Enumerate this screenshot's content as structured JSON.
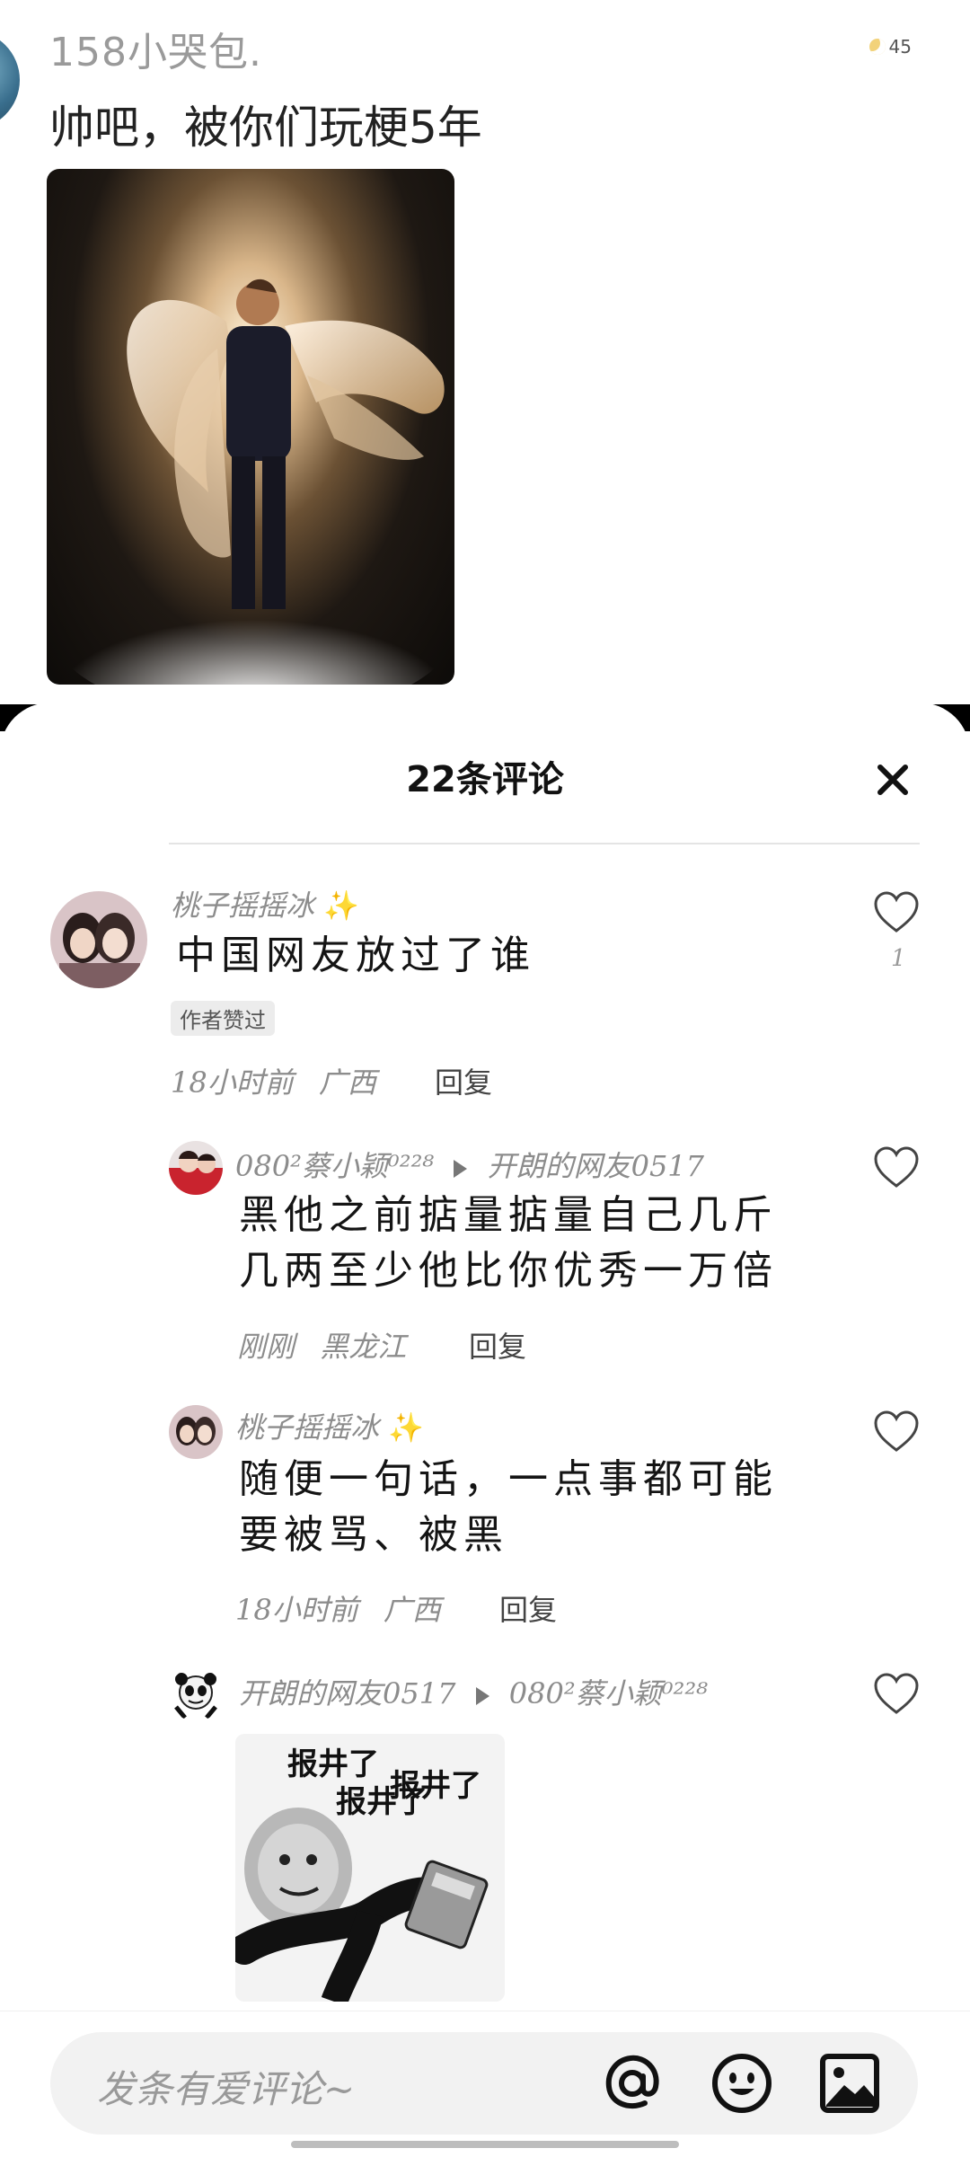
{
  "post": {
    "author": "158小哭包.",
    "title": "帅吧，被你们玩梗5年",
    "status_number": "45"
  },
  "sheet": {
    "title": "22条评论"
  },
  "comments": [
    {
      "user": "桃子摇摇冰",
      "text": "中国网友放过了谁",
      "badge": "作者赞过",
      "time": "18小时前",
      "location": "广西",
      "reply_label": "回复",
      "likes": "1"
    },
    {
      "user": "080²蔡小颖⁰²²⁸",
      "reply_to": "开朗的网友0517",
      "text_line1": "黑他之前掂量掂量自己几斤",
      "text_line2": "几两至少他比你优秀一万倍",
      "time": "刚刚",
      "location": "黑龙江",
      "reply_label": "回复"
    },
    {
      "user": "桃子摇摇冰",
      "text_line1": "随便一句话，一点事都可能",
      "text_line2": "要被骂、被黑",
      "time": "18小时前",
      "location": "广西",
      "reply_label": "回复"
    },
    {
      "user": "开朗的网友0517",
      "reply_to": "080²蔡小颖⁰²²⁸",
      "sticker_text_1": "报井了",
      "sticker_text_2": "报井了",
      "sticker_text_3": "报井了"
    }
  ],
  "input": {
    "placeholder": "发条有爱评论~"
  },
  "icons": [
    "close-icon",
    "heart-icon",
    "at-icon",
    "emoji-icon",
    "image-icon",
    "play-arrow-icon"
  ]
}
